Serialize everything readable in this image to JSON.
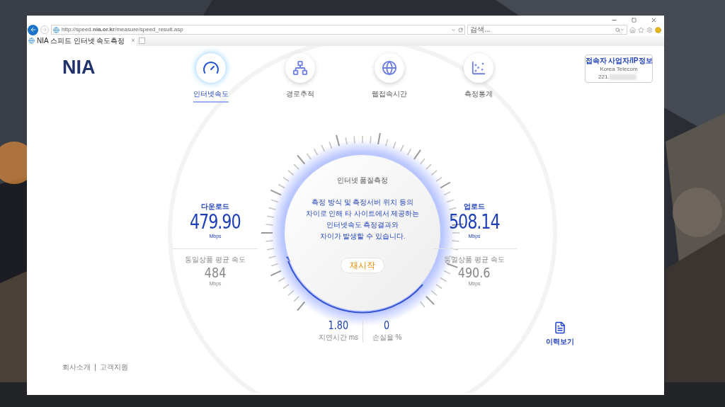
{
  "browser": {
    "url": "http://speed.**nia.or.kr**/measure/speed_result.asp",
    "search_placeholder": "검색...",
    "tab_title": "NIA 스피드 인터넷 속도측정",
    "tab_close": "×"
  },
  "logo": "NIA",
  "nav": [
    {
      "label": "인터넷속도",
      "selected": true,
      "kind": "gauge"
    },
    {
      "label": "경로추적",
      "selected": false,
      "kind": "route"
    },
    {
      "label": "웹접속시간",
      "selected": false,
      "kind": "globe"
    },
    {
      "label": "측정통계",
      "selected": false,
      "kind": "chart"
    }
  ],
  "ip_info": {
    "title": "접속자 사업자/IP정보",
    "isp": "Korea Telecom",
    "ip": "221."
  },
  "download": {
    "label": "다운로드",
    "value": "479.90",
    "unit": "Mbps",
    "avg_label": "동일상품 평균 속도",
    "avg_value": "484",
    "avg_unit": "Mbps"
  },
  "upload": {
    "label": "업로드",
    "value": "508.14",
    "unit": "Mbps",
    "avg_label": "동일상품 평균 속도",
    "avg_value": "490.6",
    "avg_unit": "Mbps"
  },
  "dial": {
    "title": "인터넷 품질측정",
    "notice": "측정 방식 및 측정서버 위치 등의\n차이로 인해 타 사이트에서 제공하는\n인터넷속도 측정결과와\n차이가 발생할 수 있습니다.",
    "restart": "재시작"
  },
  "metrics": [
    {
      "value": "1.80",
      "label": "지연시간",
      "unit": "ms"
    },
    {
      "value": "0",
      "label": "손실율",
      "unit": "%"
    }
  ],
  "history": "이력보기",
  "footer": [
    "회사소개",
    "고객지원"
  ]
}
